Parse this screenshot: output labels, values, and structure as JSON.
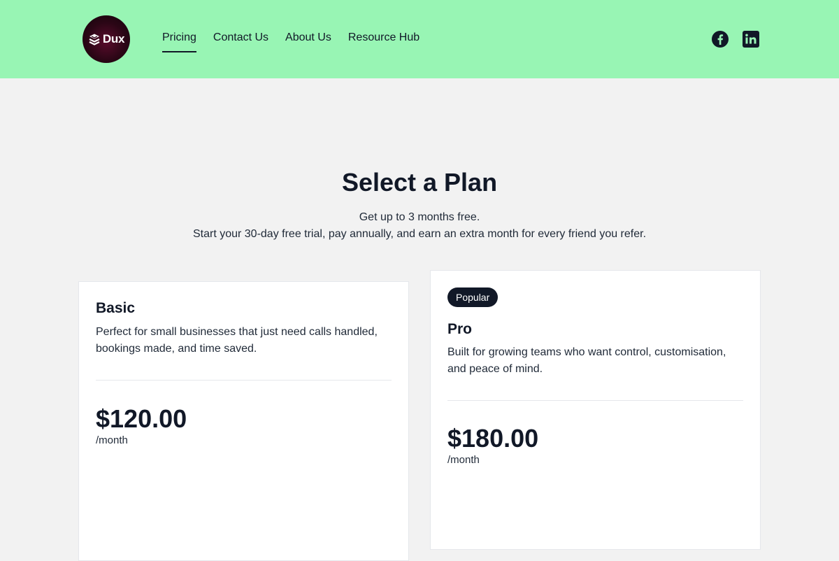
{
  "brand": {
    "logo_text": "Dux"
  },
  "nav": {
    "items": [
      {
        "label": "Pricing",
        "active": true
      },
      {
        "label": "Contact Us"
      },
      {
        "label": "About Us"
      },
      {
        "label": "Resource Hub"
      }
    ]
  },
  "socials": [
    {
      "icon": "facebook-icon"
    },
    {
      "icon": "linkedin-icon"
    }
  ],
  "hero": {
    "title": "Select a Plan",
    "subtitle_line1": "Get up to 3 months free.",
    "subtitle_line2": "Start your 30-day free trial, pay annually, and earn an extra month for every friend you refer."
  },
  "plans": [
    {
      "name": "Basic",
      "description": "Perfect for small businesses that just need calls handled, bookings made, and time saved.",
      "price": "$120.00",
      "period": "/month"
    },
    {
      "badge": "Popular",
      "name": "Pro",
      "description": "Built for growing teams who want control, customisation, and peace of mind.",
      "price": "$180.00",
      "period": "/month"
    }
  ],
  "colors": {
    "header_bg": "#98f5b4",
    "page_bg": "#f2f2f2",
    "text_dark": "#111827",
    "badge_bg": "#111827"
  }
}
